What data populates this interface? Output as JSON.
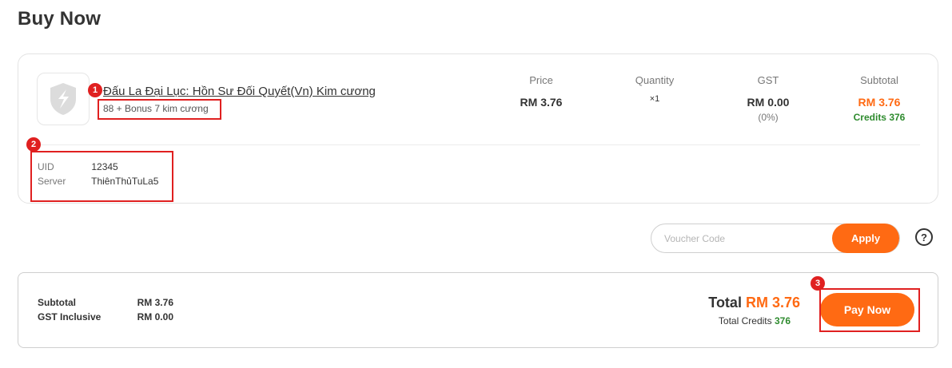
{
  "page": {
    "title": "Buy Now"
  },
  "product": {
    "name": "Đấu La Đại Lục: Hồn Sư Đối Quyết(Vn) Kim cương",
    "variant": "88 + Bonus 7 kim cương"
  },
  "columns": {
    "price": {
      "label": "Price",
      "value": "RM 3.76"
    },
    "quantity": {
      "label": "Quantity",
      "value": "×1"
    },
    "gst": {
      "label": "GST",
      "value": "RM 0.00",
      "rate": "(0%)"
    },
    "subtotal": {
      "label": "Subtotal",
      "value": "RM 3.76",
      "credits": "Credits 376"
    }
  },
  "account_info": [
    {
      "label": "UID",
      "value": "12345"
    },
    {
      "label": "Server",
      "value": "ThiênThủTuLa5"
    }
  ],
  "voucher": {
    "placeholder": "Voucher Code",
    "apply_label": "Apply"
  },
  "help": {
    "icon": "question-mark-icon",
    "glyph": "?"
  },
  "summary": {
    "subtotal_label": "Subtotal",
    "subtotal_value": "RM 3.76",
    "gst_label": "GST Inclusive",
    "gst_value": "RM 0.00",
    "total_label": "Total",
    "total_value": "RM 3.76",
    "total_credits_label": "Total Credits",
    "total_credits_value": "376",
    "pay_label": "Pay Now"
  },
  "annotations": [
    "1",
    "2",
    "3"
  ],
  "colors": {
    "accent": "#ff6a13",
    "credits": "#2e8b2e",
    "annotation": "#e02020"
  }
}
